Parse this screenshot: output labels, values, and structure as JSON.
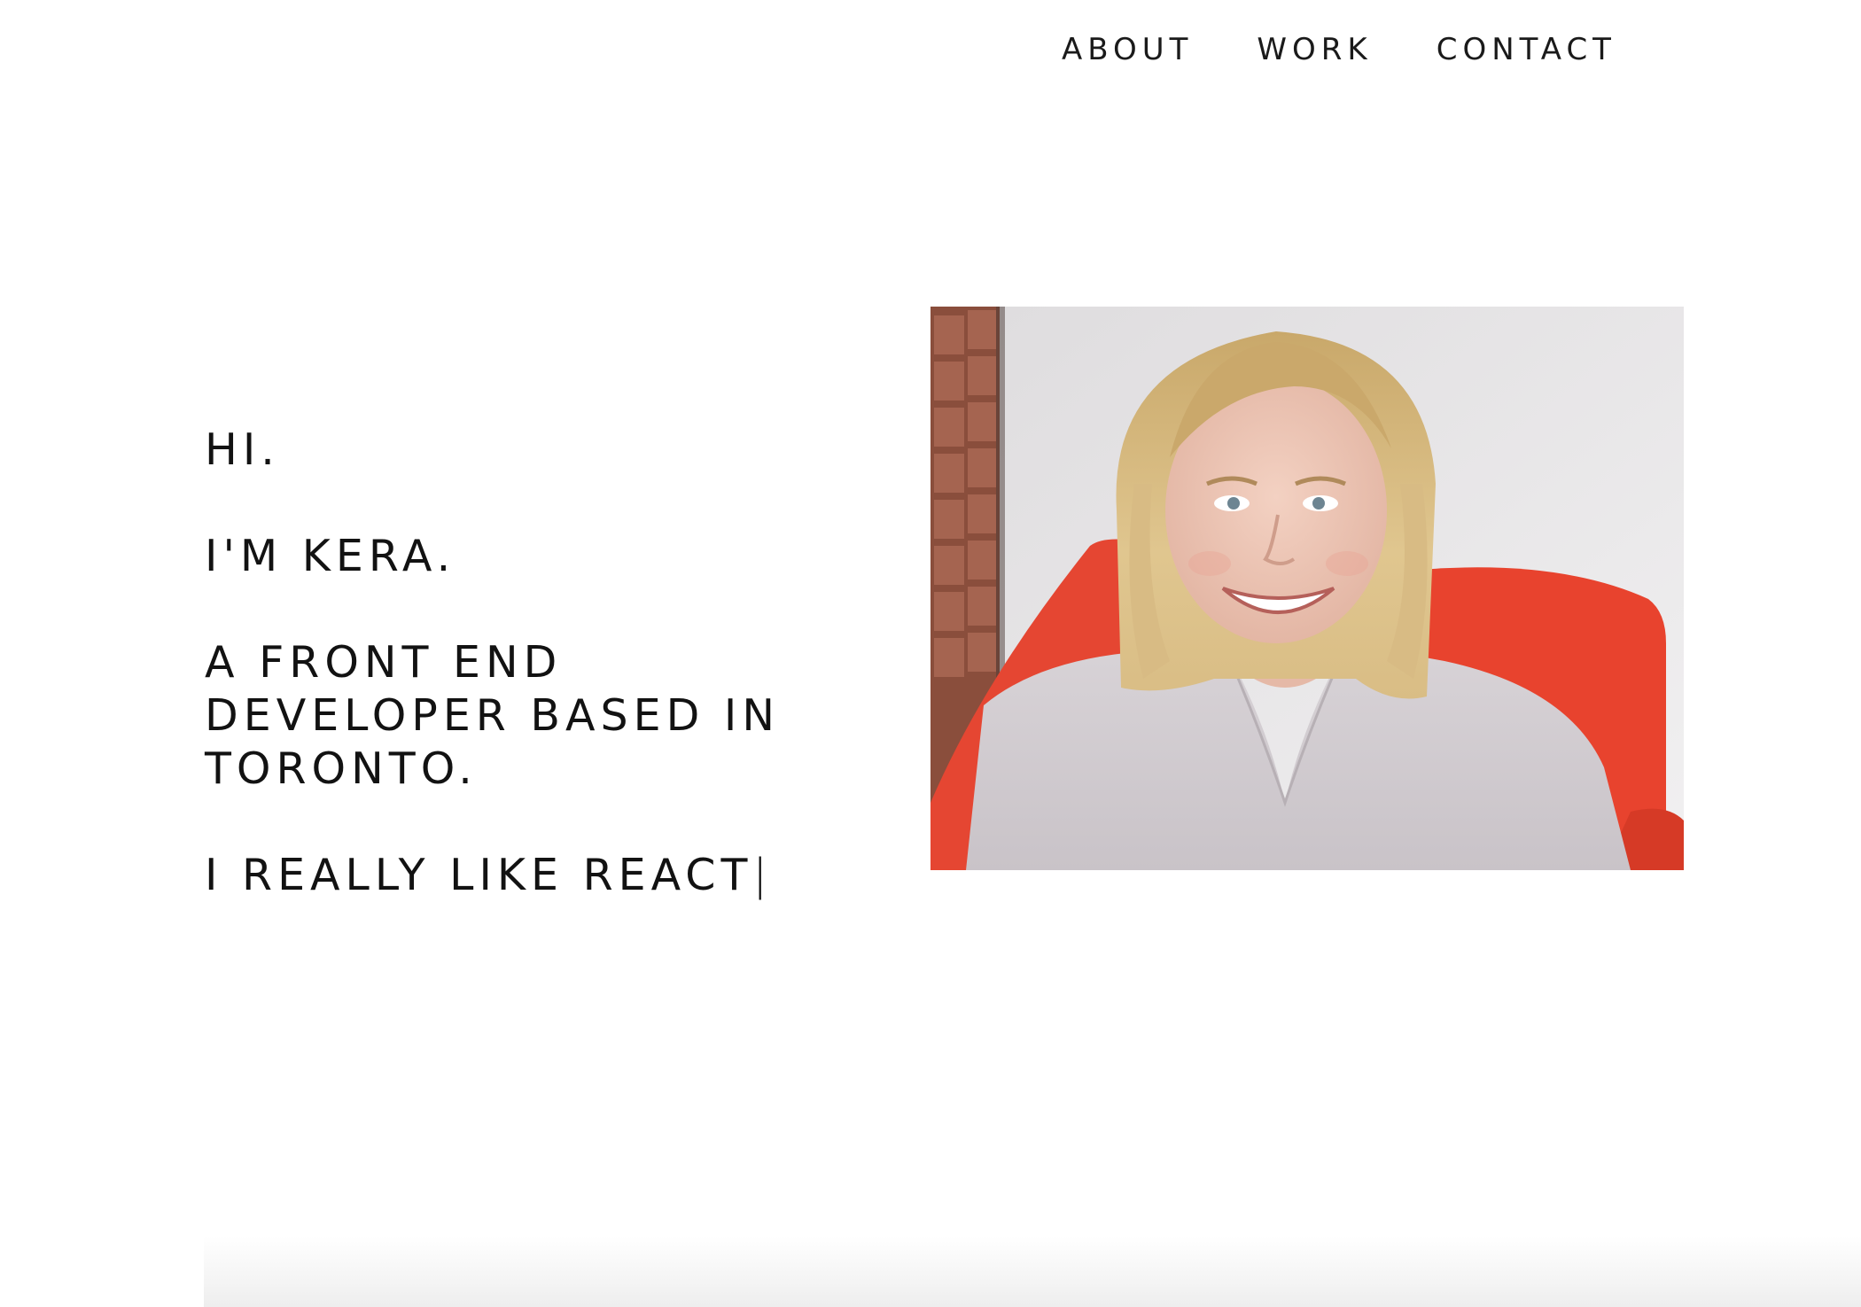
{
  "nav": {
    "items": [
      {
        "label": "ABOUT"
      },
      {
        "label": "WORK"
      },
      {
        "label": "CONTACT"
      }
    ]
  },
  "hero": {
    "greeting": "HI.",
    "intro": "I'M KERA.",
    "role_lines": [
      "A FRONT END",
      "DEVELOPER BASED IN",
      "TORONTO."
    ],
    "typing_text": "I REALLY LIKE REACT",
    "cursor": "|"
  },
  "colors": {
    "background": "#ffffff",
    "text": "#141414",
    "couch_accent": "#e8432e"
  },
  "icons": {
    "portrait": "portrait-photo"
  }
}
